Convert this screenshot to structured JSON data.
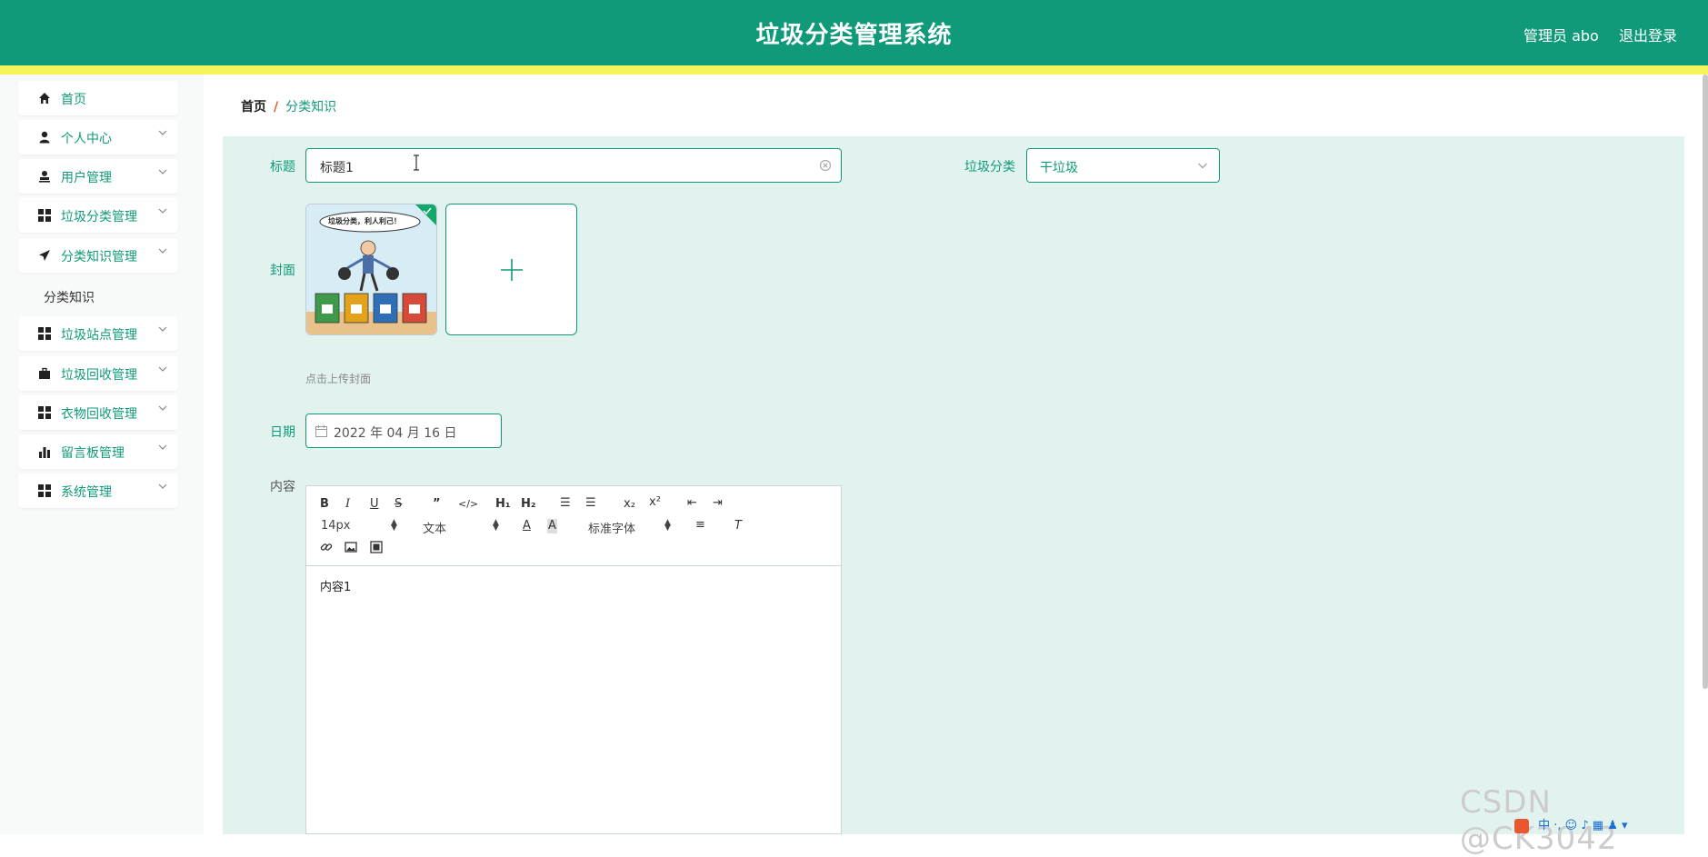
{
  "header": {
    "title": "垃圾分类管理系统",
    "user": "管理员 abo",
    "logout": "退出登录"
  },
  "sidebar": {
    "items": [
      {
        "label": "首页",
        "icon": "home-icon"
      },
      {
        "label": "个人中心",
        "icon": "person-icon"
      },
      {
        "label": "用户管理",
        "icon": "user-stamp-icon"
      },
      {
        "label": "垃圾分类管理",
        "icon": "grid-icon"
      },
      {
        "label": "分类知识管理",
        "icon": "paper-plane-icon"
      },
      {
        "label": "垃圾站点管理",
        "icon": "grid-icon"
      },
      {
        "label": "垃圾回收管理",
        "icon": "briefcase-icon"
      },
      {
        "label": "衣物回收管理",
        "icon": "grid-icon"
      },
      {
        "label": "留言板管理",
        "icon": "bar-chart-icon"
      },
      {
        "label": "系统管理",
        "icon": "grid-icon"
      }
    ],
    "submenu": "分类知识"
  },
  "breadcrumb": {
    "home": "首页",
    "separator": "/",
    "current": "分类知识"
  },
  "form": {
    "title_label": "标题",
    "title_value": "标题1",
    "category_label": "垃圾分类",
    "category_value": "干垃圾",
    "cover_label": "封面",
    "cover_image_caption": "垃圾分类，利人利己！",
    "upload_hint": "点击上传封面",
    "date_label": "日期",
    "date_value": "2022 年 04 月 16 日",
    "content_label": "内容",
    "content_value": "内容1"
  },
  "editor": {
    "font_size": "14px",
    "paragraph_style": "文本",
    "font_family": "标准字体"
  },
  "watermark": "CSDN @CK3042",
  "colors": {
    "primary": "#119a7a",
    "header_strip": "#f6f45a",
    "panel_bg": "#e2f3ef",
    "breadcrumb_separator": "#e05a2a"
  }
}
